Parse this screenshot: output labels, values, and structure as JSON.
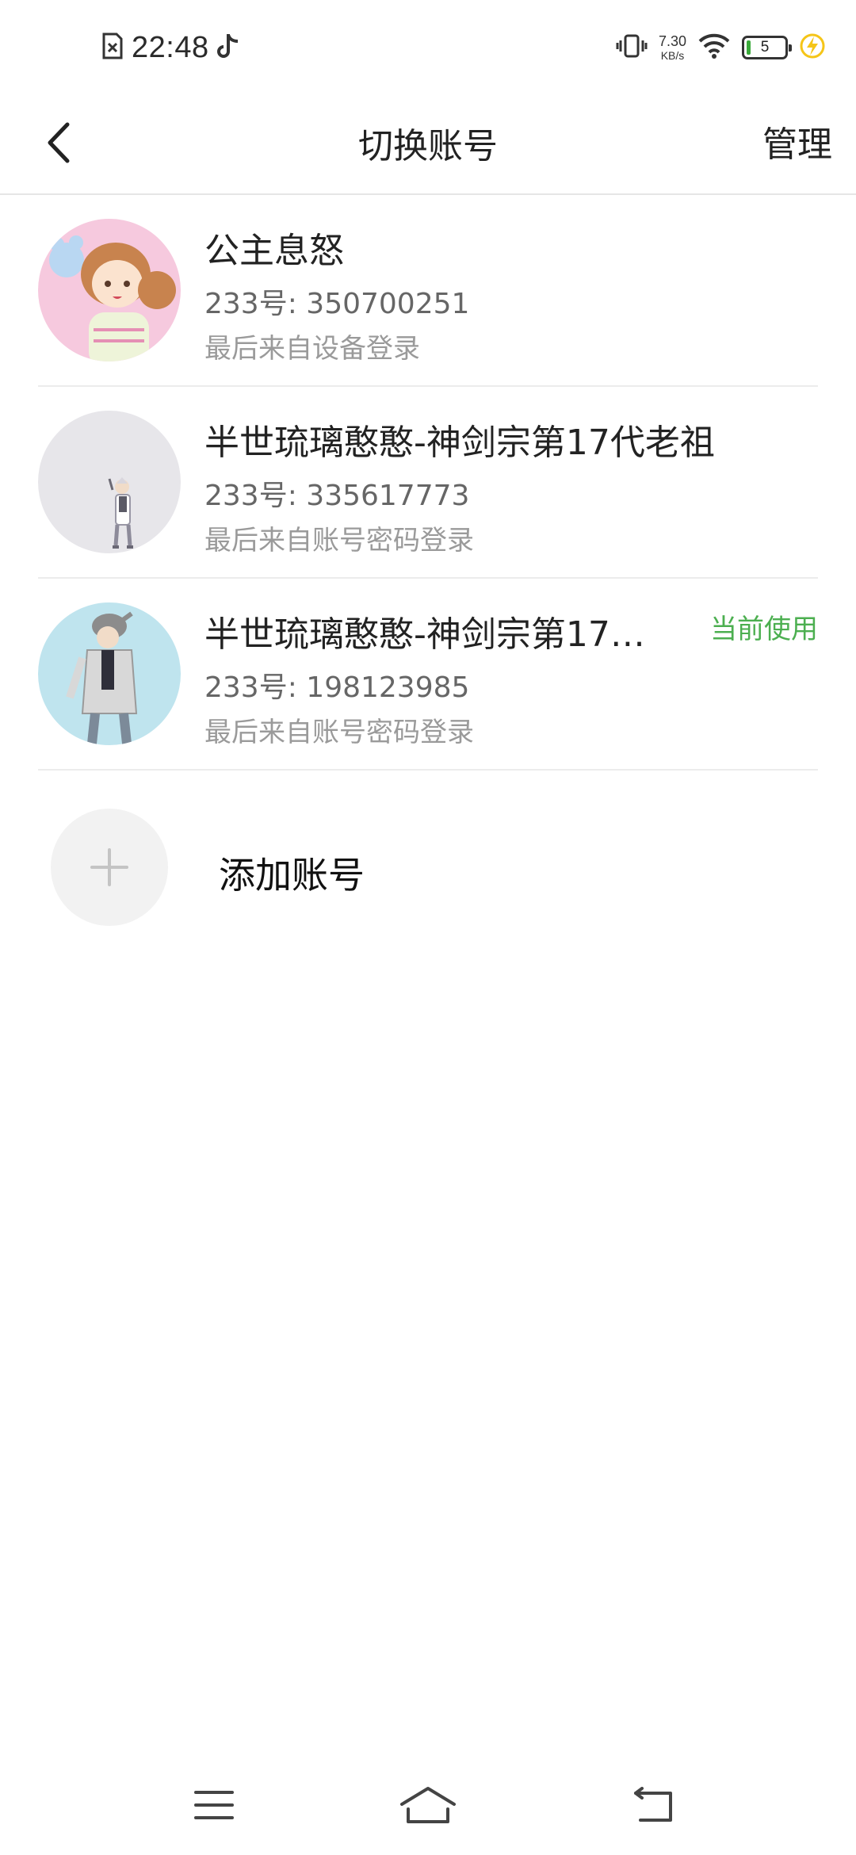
{
  "status_bar": {
    "time": "22:48",
    "net_speed_value": "7.30",
    "net_speed_unit": "KB/s",
    "battery_level": "5"
  },
  "header": {
    "title": "切换账号",
    "manage_label": "管理"
  },
  "accounts": [
    {
      "name": "公主息怒",
      "id_text": "233号: 350700251",
      "login_text": "最后来自设备登录"
    },
    {
      "name": "半世琉璃憨憨-神剑宗第17代老祖",
      "id_text": "233号: 335617773",
      "login_text": "最后来自账号密码登录"
    },
    {
      "name": "半世琉璃憨憨-神剑宗第17…",
      "id_text": "233号: 198123985",
      "login_text": "最后来自账号密码登录",
      "badge": "当前使用"
    }
  ],
  "add_account": {
    "label": "添加账号"
  },
  "colors": {
    "accent_green": "#4caf50",
    "divider": "#ececec"
  }
}
